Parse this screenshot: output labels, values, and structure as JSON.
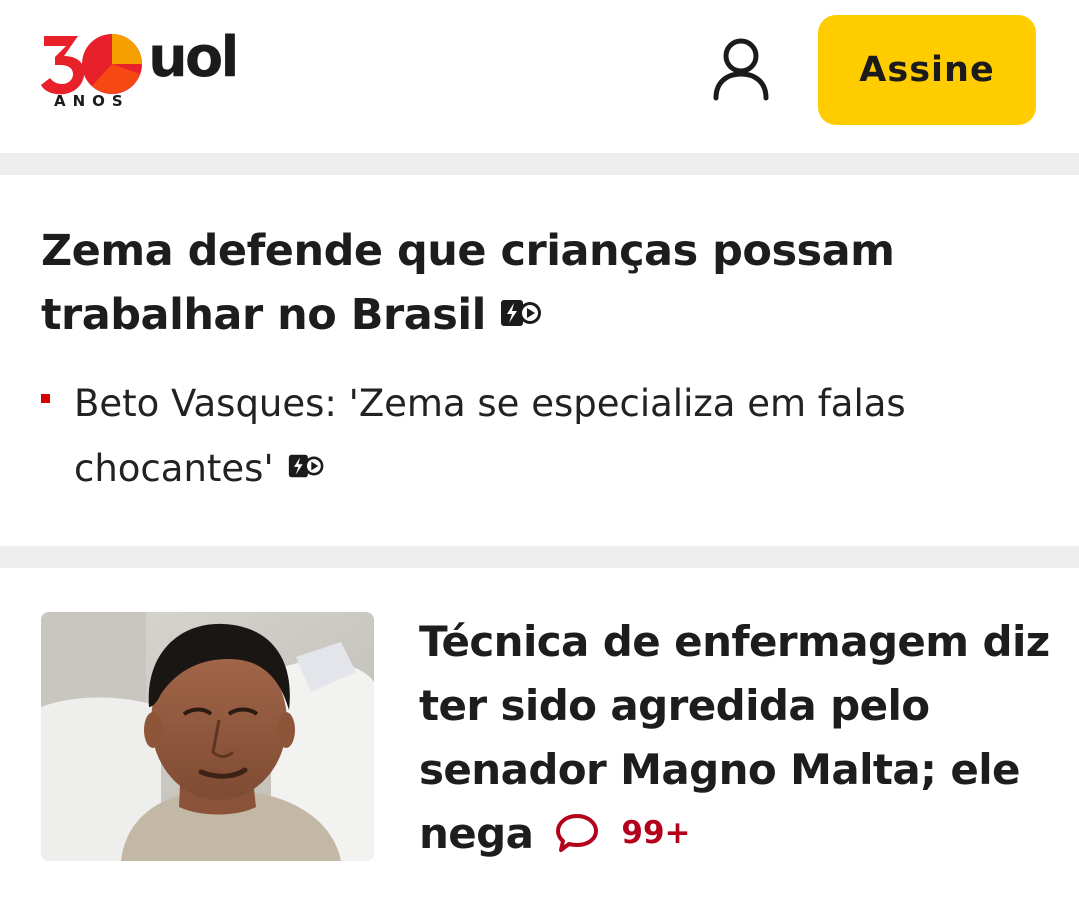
{
  "header": {
    "logo": {
      "number": "30",
      "brand": "uol",
      "anniversary_label": "ANOS"
    },
    "user_icon": "user-profile-icon",
    "subscribe_label": "Assine"
  },
  "colors": {
    "accent_yellow": "#ffcc00",
    "bullet_red": "#d60000",
    "comment_red": "#b3001b",
    "logo_red": "#e8202a",
    "logo_orange": "#f5a000",
    "separator": "#eeeeee"
  },
  "story1": {
    "headline": "Zema defende que crianças possam trabalhar no Brasil",
    "headline_badge_icon": "video-short-icon",
    "related": {
      "text": "Beto Vasques: 'Zema se especializa em falas chocantes'",
      "badge_icon": "video-short-icon"
    }
  },
  "story2": {
    "image_icon": "news-photo",
    "headline": "Técnica de enfermagem diz ter sido agredida pelo senador Magno Malta; ele nega",
    "comments_icon": "comment-bubble-icon",
    "comments_count": "99+"
  }
}
